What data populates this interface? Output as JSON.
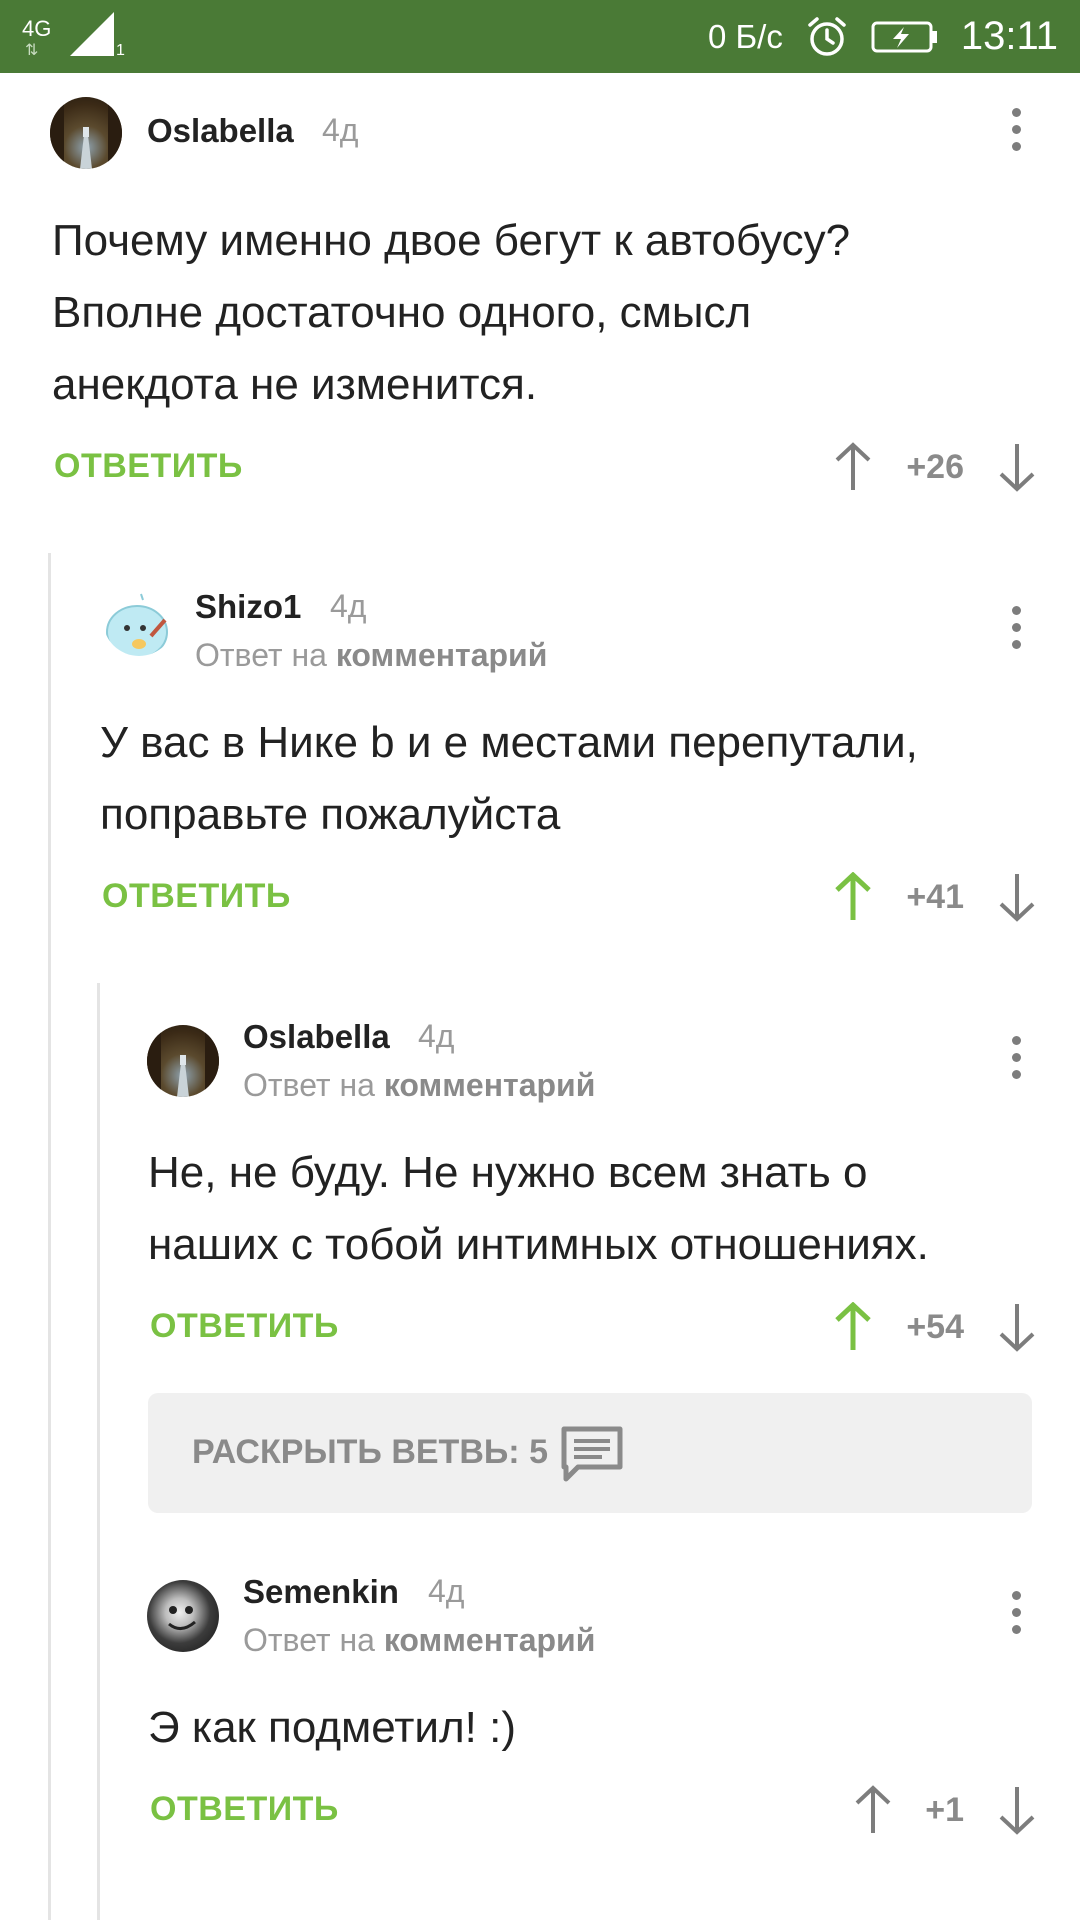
{
  "status_bar": {
    "network": "4G",
    "signal_sub": "1",
    "speed": "0 Б/с",
    "time": "13:11",
    "icons": [
      "signal-icon",
      "alarm-icon",
      "battery-charging-icon"
    ]
  },
  "comments": [
    {
      "username": "Oslabella",
      "age": "4д",
      "body_lines": [
        "Почему именно двое бегут к автобусу?",
        "Вполне достаточно одного, смысл",
        "анекдота не изменится."
      ],
      "reply_label": "ОТВЕТИТЬ",
      "score": "+26",
      "upvoted": false
    },
    {
      "username": "Shizo1",
      "age": "4д",
      "reply_to_prefix": "Ответ на",
      "reply_to_target": "комментарий",
      "body_lines": [
        "У вас в Нике b и е местами перепутали,",
        "поправьте пожалуйста"
      ],
      "reply_label": "ОТВЕТИТЬ",
      "score": "+41",
      "upvoted": true
    },
    {
      "username": "Oslabella",
      "age": "4д",
      "reply_to_prefix": "Ответ на",
      "reply_to_target": "комментарий",
      "body_lines": [
        "Не, не буду. Не нужно всем знать о",
        "наших с тобой интимных отношениях."
      ],
      "reply_label": "ОТВЕТИТЬ",
      "score": "+54",
      "upvoted": true
    },
    {
      "username": "Semenkin",
      "age": "4д",
      "reply_to_prefix": "Ответ на",
      "reply_to_target": "комментарий",
      "body_lines": [
        "Э как подметил! :)"
      ],
      "reply_label": "ОТВЕТИТЬ",
      "score": "+1",
      "upvoted": false
    }
  ],
  "expand_thread": {
    "label": "РАСКРЫТЬ ВЕТВЬ: 5"
  },
  "colors": {
    "status_bar": "#4a7a36",
    "accent_green": "#7ac143",
    "upvote_active": "#7ac143",
    "vote_inactive": "#7d7d7d"
  }
}
